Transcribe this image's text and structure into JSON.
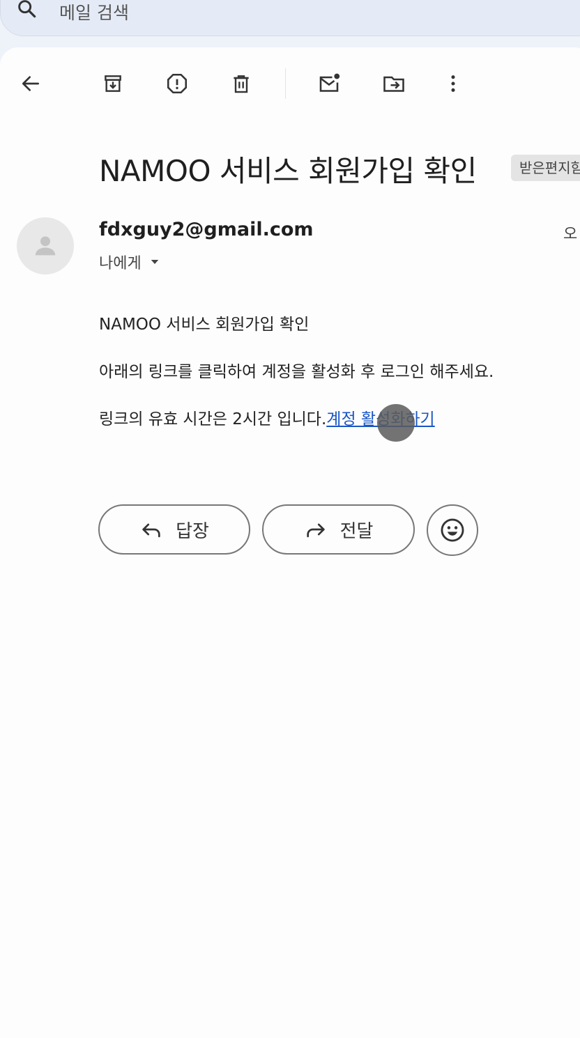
{
  "search": {
    "placeholder": "메일 검색"
  },
  "toolbar": {
    "back": "back-arrow-icon",
    "archive": "archive-icon",
    "report_spam": "report-spam-icon",
    "delete": "trash-icon",
    "mark_unread": "mark-unread-icon",
    "move_to": "move-to-folder-icon",
    "more": "more-vert-icon"
  },
  "email": {
    "subject": "NAMOO 서비스 회원가입 확인",
    "label": "받은편지함",
    "sender": "fdxguy2@gmail.com",
    "time": "오",
    "recipient": "나에게",
    "body_line1": "NAMOO 서비스 회원가입 확인",
    "body_line2": "아래의 링크를 클릭하여 계정을 활성화 후 로그인 해주세요.",
    "body_line3": "링크의 유효 시간은 2시간 입니다.",
    "link_text": "계정 활성화하기"
  },
  "actions": {
    "reply": "답장",
    "forward": "전달"
  },
  "colors": {
    "link": "#1a56c5",
    "background": "#fdfdfd",
    "header_bg": "#e5ebf6"
  }
}
